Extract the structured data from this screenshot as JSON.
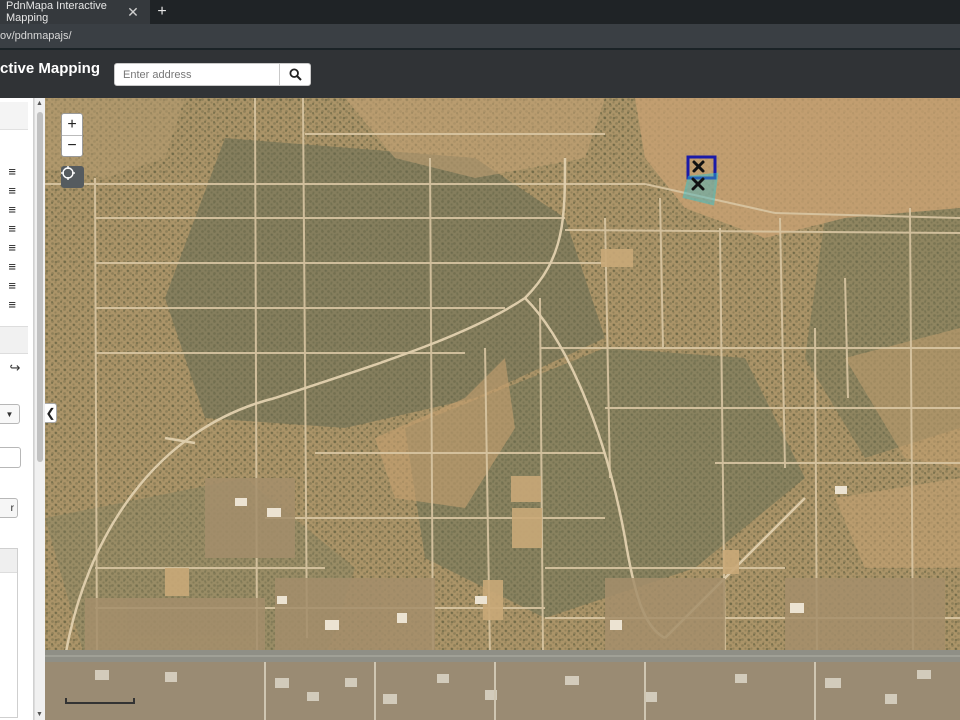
{
  "browser": {
    "tab_title": "PdnMapa Interactive Mapping",
    "tab_close": "✕",
    "new_tab": "+",
    "url": "ov/pdnmapajs/"
  },
  "header": {
    "title": "ctive Mapping",
    "search_placeholder": "Enter address",
    "search_icon": "search-icon"
  },
  "side_panel": {
    "layer_rows": [
      "≡",
      "≡",
      "≡",
      "≡",
      "≡",
      "≡",
      "≡",
      "≡"
    ],
    "share_icon": "↪",
    "select_arrow": "▼",
    "button_label": "r"
  },
  "map": {
    "zoom_in": "+",
    "zoom_out": "−",
    "locate_icon": "locate-icon",
    "collapse_arrow": "❮",
    "basemap": "aerial imagery",
    "selected_parcel_outline": "#1a1aa8",
    "highlight_parcel_outline": "#21c7d8"
  }
}
